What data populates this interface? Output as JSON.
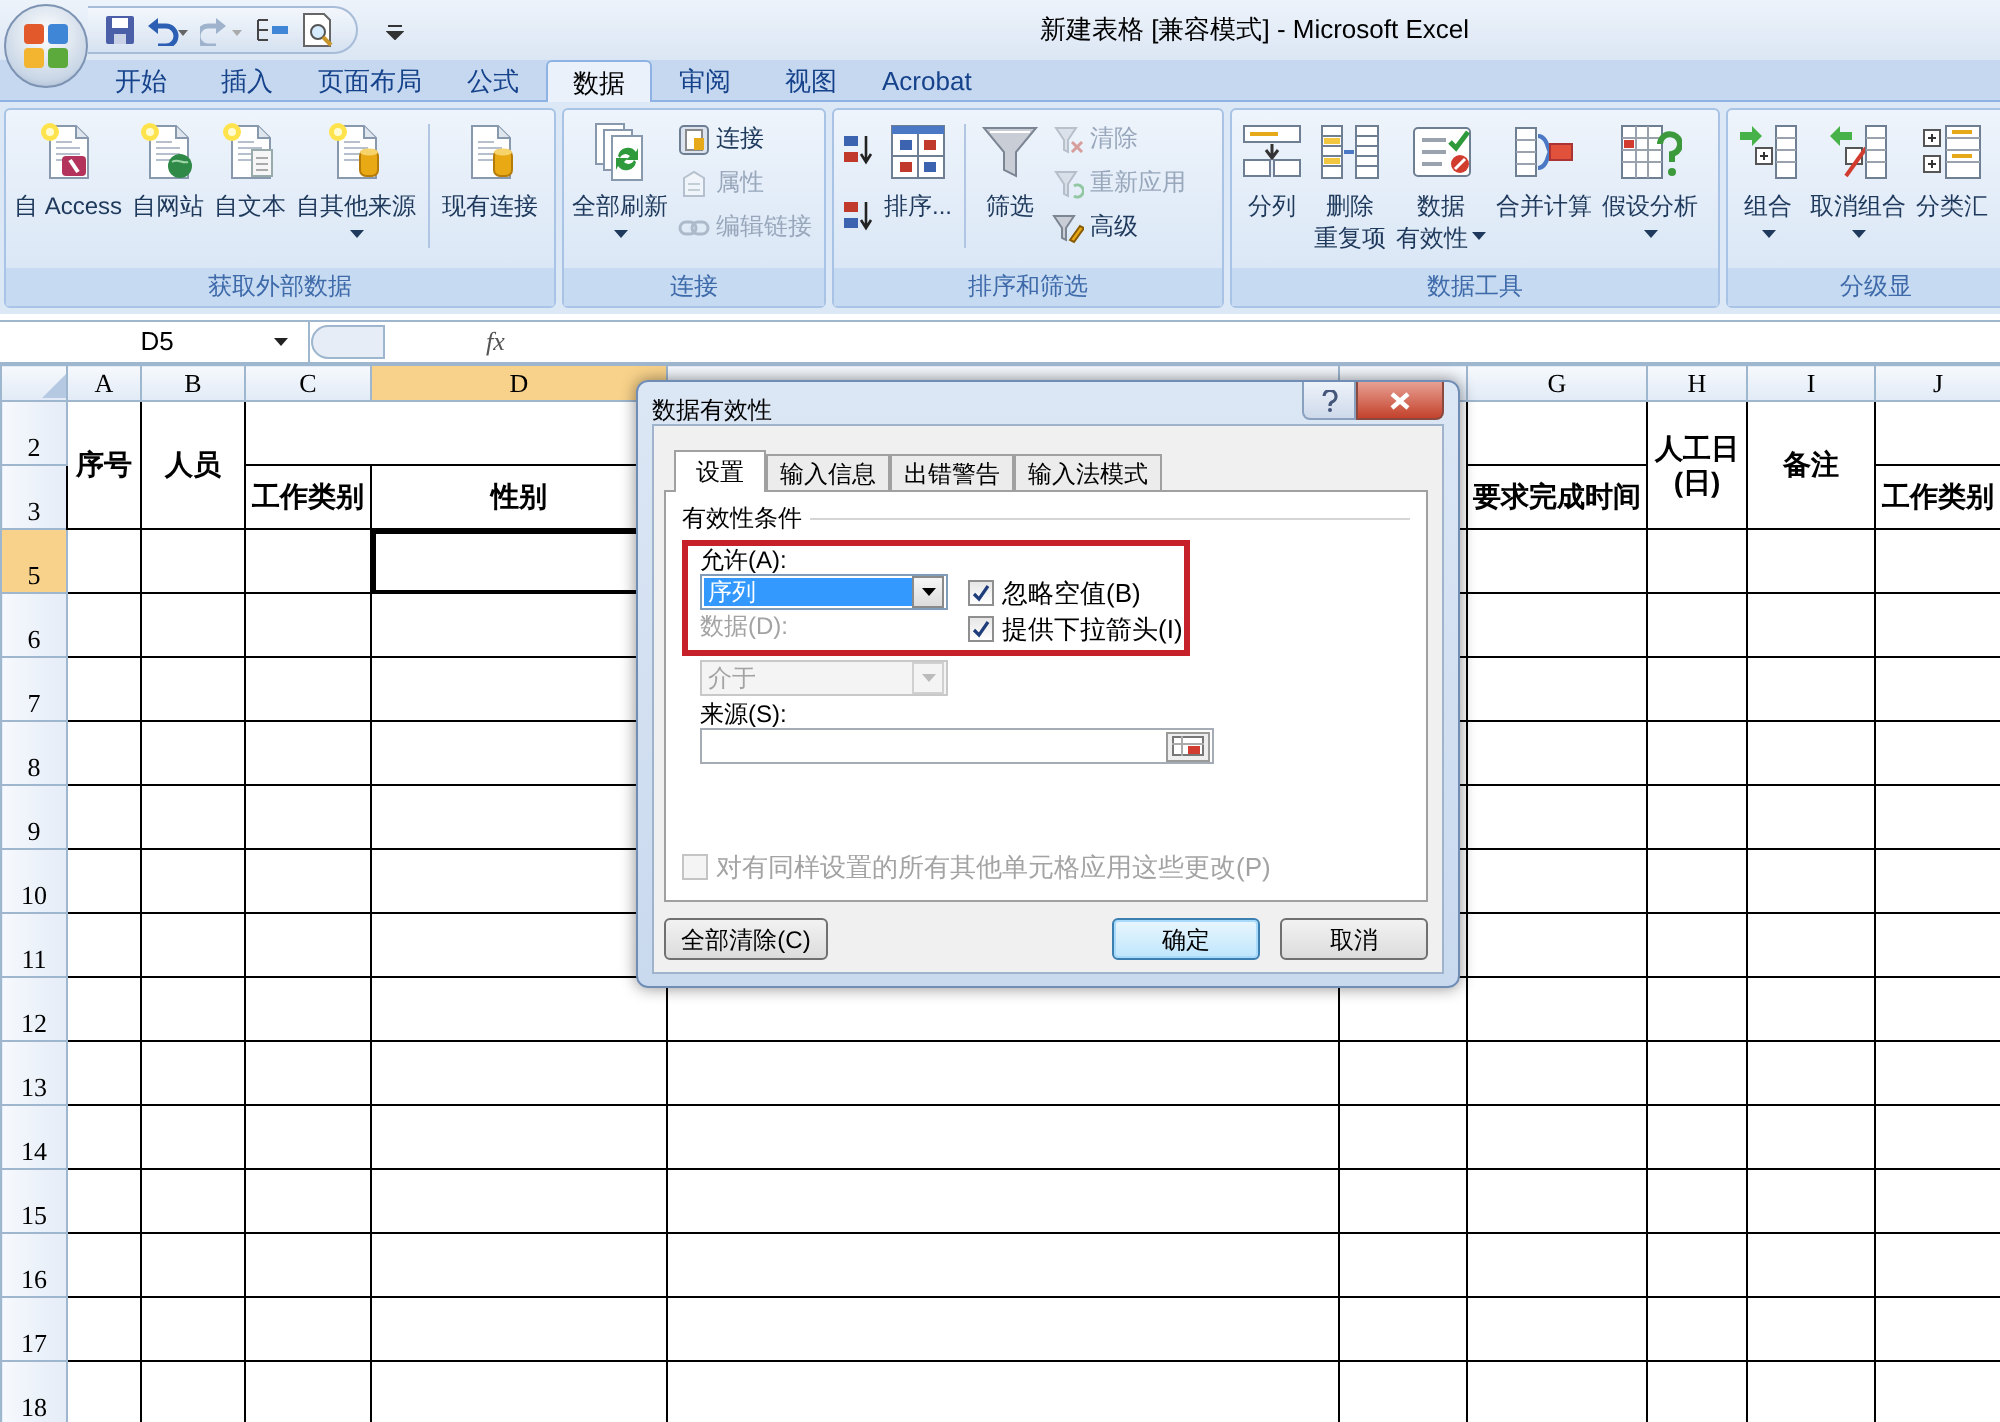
{
  "window": {
    "title": "新建表格  [兼容模式] - Microsoft Excel"
  },
  "ribbon_tabs": [
    {
      "label": "开始",
      "selected": false
    },
    {
      "label": "插入",
      "selected": false
    },
    {
      "label": "页面布局",
      "selected": false
    },
    {
      "label": "公式",
      "selected": false
    },
    {
      "label": "数据",
      "selected": true
    },
    {
      "label": "审阅",
      "selected": false
    },
    {
      "label": "视图",
      "selected": false
    },
    {
      "label": "Acrobat",
      "selected": false
    }
  ],
  "ribbon_groups": [
    {
      "title": "获取外部数据",
      "buttons": [
        {
          "kind": "large",
          "label": "自 Access"
        },
        {
          "kind": "large",
          "label": "自网站"
        },
        {
          "kind": "large",
          "label": "自文本"
        },
        {
          "kind": "large",
          "label": "自其他来源",
          "dropdown": true
        },
        {
          "kind": "separator"
        },
        {
          "kind": "large",
          "label": "现有连接"
        }
      ]
    },
    {
      "title": "连接",
      "buttons": [
        {
          "kind": "large",
          "label": "全部刷新",
          "dropdown": true
        },
        {
          "kind": "stack",
          "items": [
            {
              "label": "连接",
              "disabled": false
            },
            {
              "label": "属性",
              "disabled": true
            },
            {
              "label": "编辑链接",
              "disabled": true
            }
          ]
        }
      ]
    },
    {
      "title": "排序和筛选",
      "buttons": [
        {
          "kind": "stack",
          "items": [
            {
              "disabled": false
            },
            {
              "disabled": false
            }
          ]
        },
        {
          "kind": "large",
          "label": "排序..."
        },
        {
          "kind": "separator"
        },
        {
          "kind": "large",
          "label": "筛选"
        },
        {
          "kind": "stack",
          "items": [
            {
              "label": "清除",
              "disabled": true
            },
            {
              "label": "重新应用",
              "disabled": true
            },
            {
              "label": "高级",
              "disabled": false
            }
          ]
        }
      ]
    },
    {
      "title": "数据工具",
      "buttons": [
        {
          "kind": "large",
          "label": "分列"
        },
        {
          "kind": "large",
          "lines": [
            "删除",
            "重复项"
          ]
        },
        {
          "kind": "large",
          "lines": [
            "数据",
            "有效性"
          ],
          "dropdown": true
        },
        {
          "kind": "large",
          "label": "合并计算"
        },
        {
          "kind": "large",
          "label": "假设分析",
          "dropdown": true
        }
      ]
    },
    {
      "title": "分级显",
      "buttons": [
        {
          "kind": "large",
          "label": "组合",
          "dropdown": true
        },
        {
          "kind": "large",
          "label": "取消组合",
          "dropdown": true
        },
        {
          "kind": "large",
          "label": "分类汇"
        }
      ]
    }
  ],
  "formula_bar": {
    "name_box": "D5",
    "function_label": "fx"
  },
  "sheet": {
    "columns": [
      {
        "label": "A",
        "selected": false
      },
      {
        "label": "B",
        "selected": false
      },
      {
        "label": "C",
        "selected": false
      },
      {
        "label": "D",
        "selected": true
      },
      {
        "label": "G",
        "selected": false
      },
      {
        "label": "H",
        "selected": false
      },
      {
        "label": "I",
        "selected": false
      },
      {
        "label": "J",
        "selected": false
      }
    ],
    "rows": [
      {
        "label": "2",
        "selected": false
      },
      {
        "label": "3",
        "selected": false
      },
      {
        "label": "5",
        "selected": true
      },
      {
        "label": "6",
        "selected": false
      },
      {
        "label": "7",
        "selected": false
      },
      {
        "label": "8",
        "selected": false
      },
      {
        "label": "9",
        "selected": false
      },
      {
        "label": "10",
        "selected": false
      },
      {
        "label": "11",
        "selected": false
      },
      {
        "label": "12",
        "selected": false
      },
      {
        "label": "13",
        "selected": false
      },
      {
        "label": "14",
        "selected": false
      },
      {
        "label": "15",
        "selected": false
      },
      {
        "label": "16",
        "selected": false
      },
      {
        "label": "17",
        "selected": false
      },
      {
        "label": "18",
        "selected": false
      }
    ],
    "header_cells": [
      "序号",
      "人员",
      "工作类别",
      "性别",
      "要求完成时间",
      "人工日\n(日)",
      "备注",
      "工作类别"
    ]
  },
  "dialog": {
    "title": "数据有效性",
    "tabs": [
      {
        "label": "设置",
        "selected": true
      },
      {
        "label": "输入信息",
        "selected": false
      },
      {
        "label": "出错警告",
        "selected": false
      },
      {
        "label": "输入法模式",
        "selected": false
      }
    ],
    "section_title": "有效性条件",
    "allow": {
      "label": "允许(A):",
      "value": "序列"
    },
    "options": [
      {
        "label": "忽略空值(B)",
        "checked": true
      },
      {
        "label": "提供下拉箭头(I)",
        "checked": true
      }
    ],
    "data": {
      "label": "数据(D):",
      "value": "介于",
      "disabled": true
    },
    "source": {
      "label": "来源(S):"
    },
    "apply_all": {
      "label": "对有同样设置的所有其他单元格应用这些更改(P)",
      "checked": false,
      "disabled": true
    },
    "buttons": [
      {
        "label": "全部清除(C)",
        "kind": "left"
      },
      {
        "label": "确定",
        "kind": "default"
      },
      {
        "label": "取消",
        "kind": "normal"
      }
    ]
  }
}
